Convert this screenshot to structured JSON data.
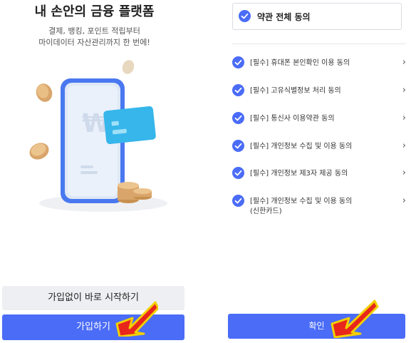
{
  "left": {
    "headline": "내 손안의 금융 플랫폼",
    "subline_1": "결제, 뱅킹, 포인트 적립부터",
    "subline_2": "마이데이터 자산관리까지 한 번에!",
    "start_without_join": "가입없이 바로 시작하기",
    "join": "가입하기"
  },
  "right": {
    "agree_all": "약관 전체 동의",
    "terms": [
      {
        "label": "[필수] 휴대폰 본인확인 이용 동의"
      },
      {
        "label": "[필수] 고유식별정보 처리 동의"
      },
      {
        "label": "[필수] 통신사 이용약관 동의"
      },
      {
        "label": "[필수] 개인정보 수집 및 이용 동의"
      },
      {
        "label": "[필수] 개인정보 제3자 제공 동의"
      },
      {
        "label": "[필수] 개인정보 수집 및 이용 동의",
        "label_2": "(신한카드)"
      }
    ],
    "confirm": "확인"
  },
  "colors": {
    "primary": "#4a6cf7",
    "secondary_button": "#eeeff2",
    "arrow_fill": "#e8261c",
    "arrow_outline": "#f2d000"
  },
  "icons": {
    "check": "check-circle-icon",
    "chevron": "chevron-right-icon",
    "pointer": "red-arrow-icon"
  }
}
